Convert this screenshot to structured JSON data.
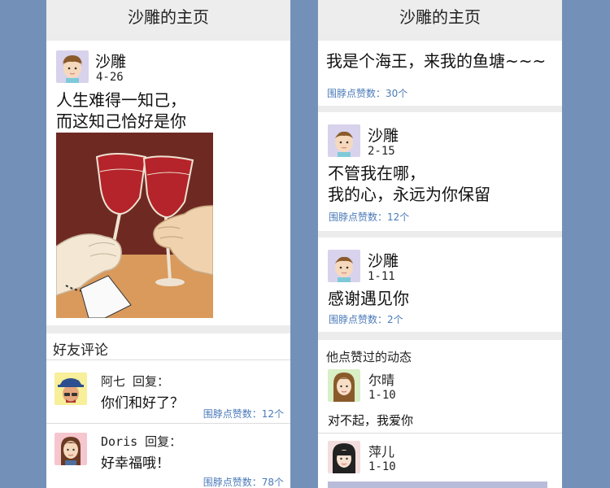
{
  "colors": {
    "page_background": "#7391b8",
    "panel_background": "#ececec",
    "like_text": "#4a7ab8"
  },
  "left_panel": {
    "header_title": "沙雕的主页",
    "post": {
      "author": "沙雕",
      "date": "4-26",
      "text": "人生难得一知己，\n而这知己恰好是你",
      "image": "wine-toast-illustration"
    },
    "comments_section_title": "好友评论",
    "comments": [
      {
        "author_reply": "阿七 回复：",
        "text": "你们和好了？",
        "likes": "围脖点赞数：12个"
      },
      {
        "author_reply": "Doris 回复：",
        "text": "好幸福哦！",
        "likes": "围脖点赞数：78个"
      }
    ]
  },
  "right_panel": {
    "header_title": "沙雕的主页",
    "posts": [
      {
        "text": "我是个海王，来我的鱼塘~~~",
        "likes": "围脖点赞数：30个"
      },
      {
        "author": "沙雕",
        "date": "2-15",
        "text": "不管我在哪，\n我的心，永远为你保留",
        "likes": "围脖点赞数：12个"
      },
      {
        "author": "沙雕",
        "date": "1-11",
        "text": "感谢遇见你",
        "likes": "围脖点赞数：2个"
      }
    ],
    "liked_section_title": "他点赞过的动态",
    "liked_posts": [
      {
        "author": "尔晴",
        "date": "1-10",
        "text": "对不起，我爱你"
      },
      {
        "author": "萍儿",
        "date": "1-10"
      }
    ]
  }
}
